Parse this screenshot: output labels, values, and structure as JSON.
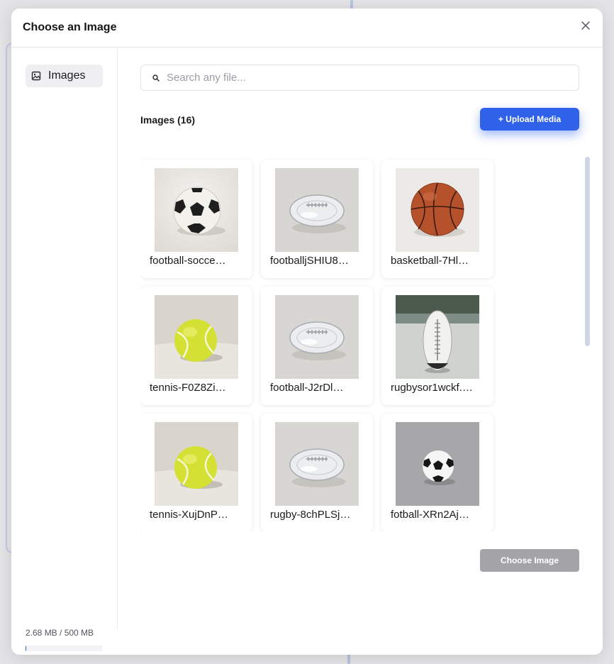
{
  "modal": {
    "title": "Choose an Image",
    "close_icon": "close-icon"
  },
  "sidebar": {
    "items": [
      {
        "label": "Images",
        "icon": "image-icon"
      }
    ],
    "storage": {
      "text": "2.68 MB / 500 MB",
      "used_fraction": 0.005
    }
  },
  "search": {
    "placeholder": "Search any file...",
    "value": "",
    "icon": "search-icon"
  },
  "gallery": {
    "heading": "Images (16)",
    "upload_label": "+ Upload Media",
    "items": [
      {
        "name": "football-socce…",
        "kind": "soccer"
      },
      {
        "name": "footballjSHIU8…",
        "kind": "glass-football"
      },
      {
        "name": "basketball-7Hl…",
        "kind": "basketball"
      },
      {
        "name": "tennis-F0Z8Zi…",
        "kind": "tennis"
      },
      {
        "name": "football-J2rDl…",
        "kind": "glass-football"
      },
      {
        "name": "rugbysor1wckf.…",
        "kind": "rugby-stadium"
      },
      {
        "name": "tennis-XujDnP…",
        "kind": "tennis"
      },
      {
        "name": "rugby-8chPLSj…",
        "kind": "glass-football"
      },
      {
        "name": "fotball-XRn2Aj…",
        "kind": "soccer-small"
      }
    ]
  },
  "footer": {
    "choose_label": "Choose Image"
  },
  "colors": {
    "accent": "#2f62e8",
    "disabled": "#a3a3a8"
  }
}
